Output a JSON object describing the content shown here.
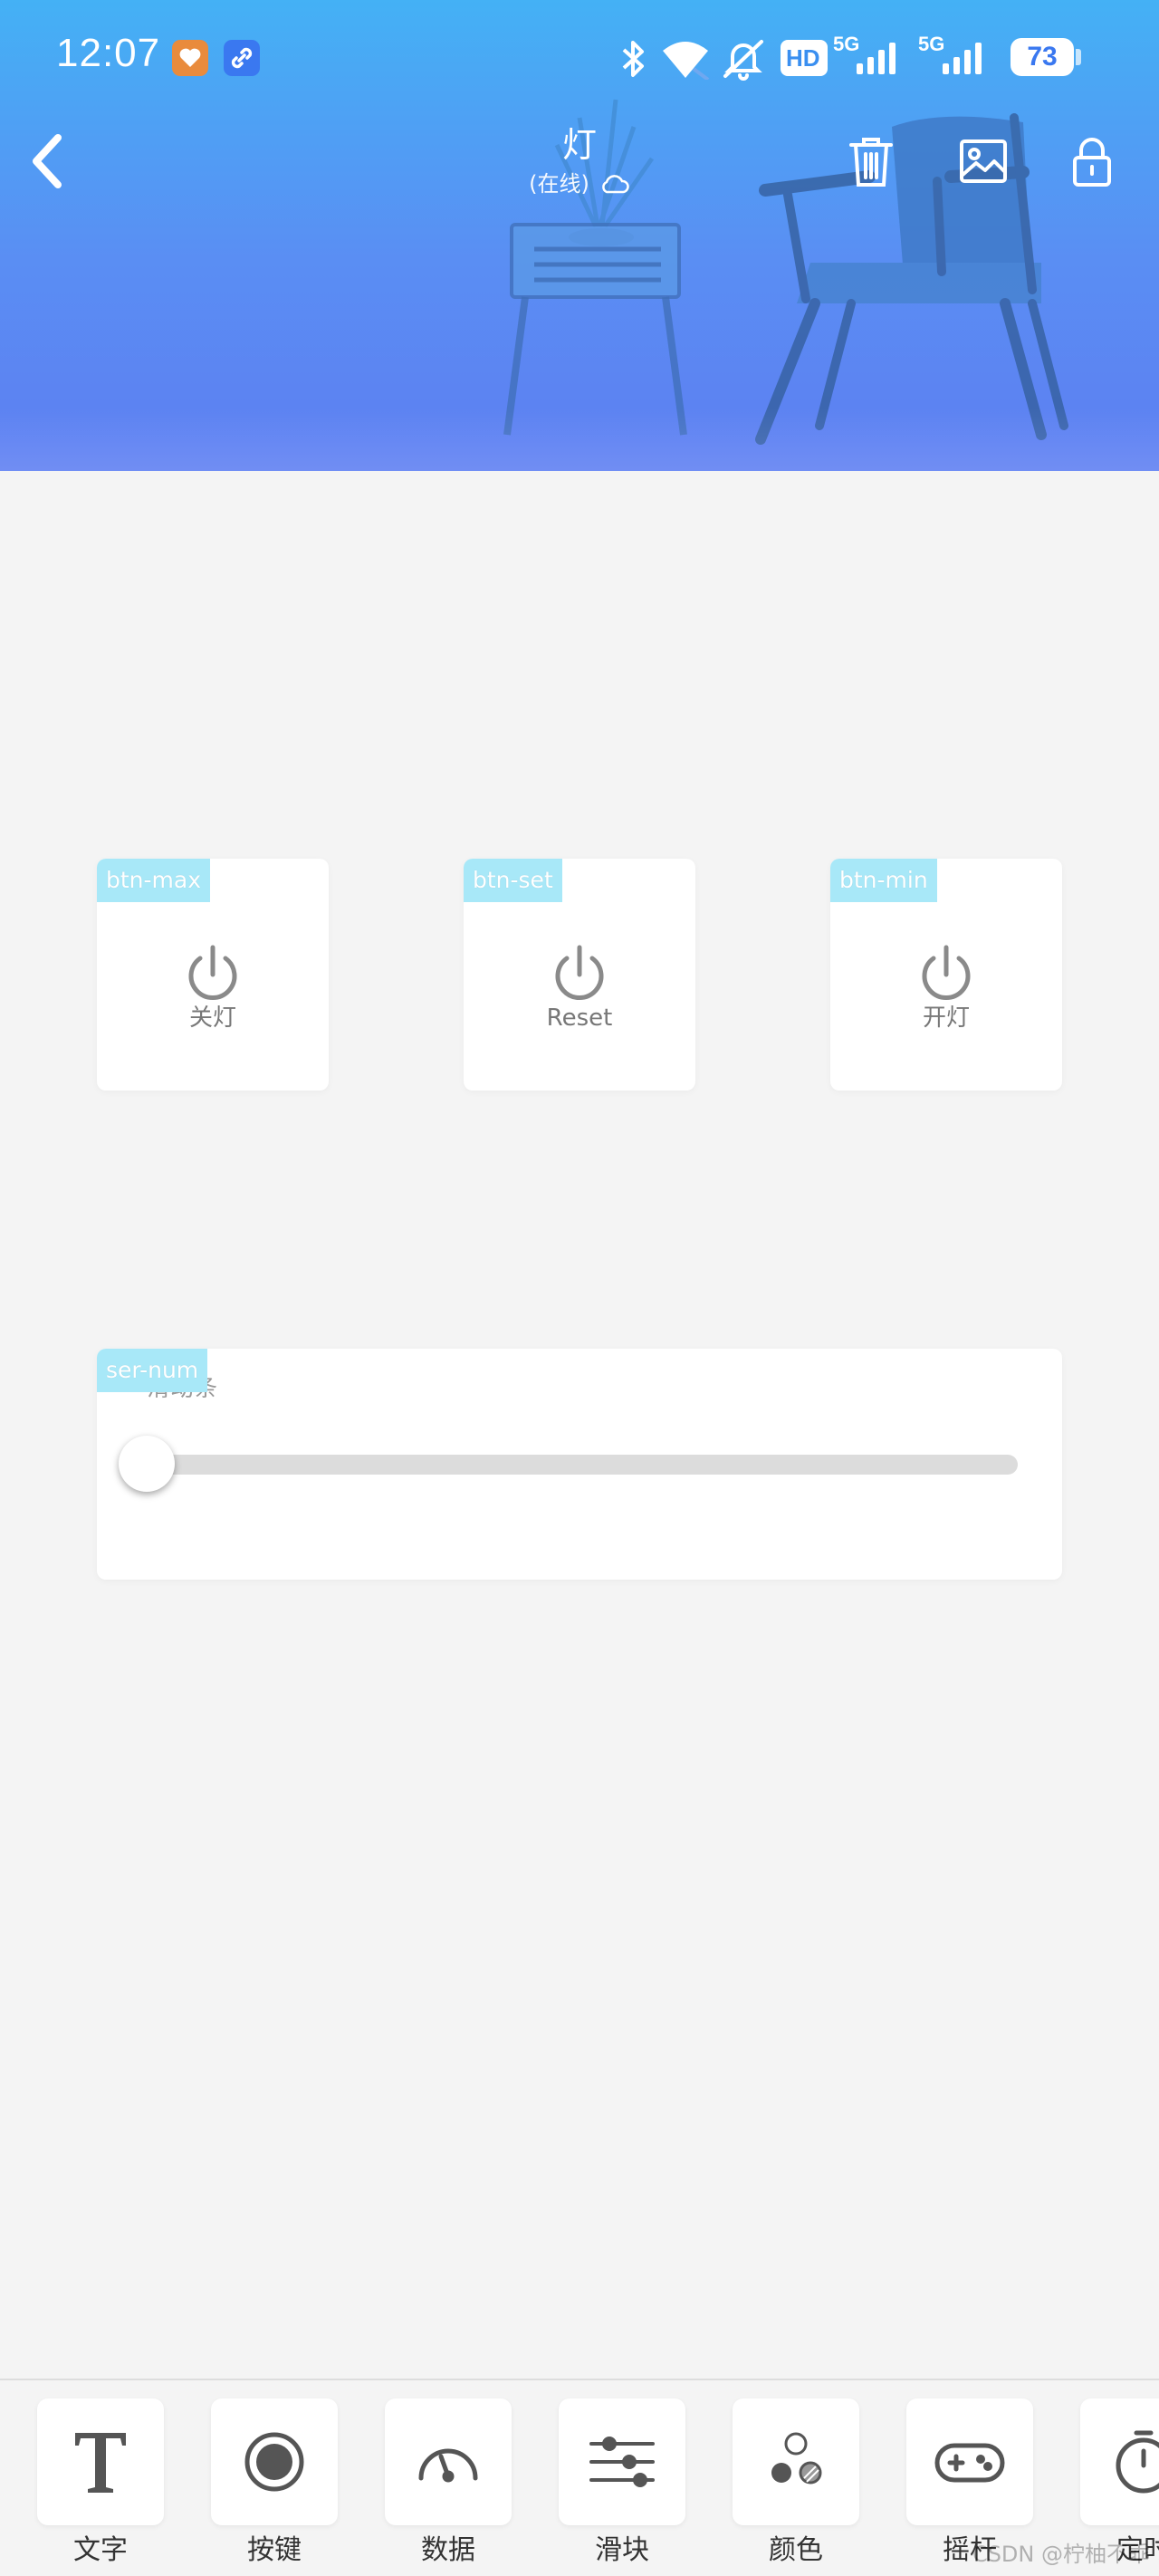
{
  "status_bar": {
    "time": "12:07",
    "hd_badge": "HD",
    "network_1": "5G",
    "network_2": "5G",
    "battery": "73",
    "icons": [
      "heart-app-icon",
      "link-app-icon",
      "bluetooth-icon",
      "wifi-icon",
      "mute-icon",
      "signal-icon",
      "signal-icon",
      "battery-icon"
    ]
  },
  "header": {
    "title": "灯",
    "subtitle": "(在线)",
    "icons": [
      "back-icon",
      "cloud-icon",
      "trash-icon",
      "image-icon",
      "lock-icon"
    ]
  },
  "buttons": [
    {
      "key": "btn-max",
      "label": "关灯",
      "icon": "power-icon"
    },
    {
      "key": "btn-set",
      "label": "Reset",
      "icon": "power-icon"
    },
    {
      "key": "btn-min",
      "label": "开灯",
      "icon": "power-icon"
    }
  ],
  "slider": {
    "key": "ser-num",
    "label": "滑动条",
    "value_fraction": 0.0
  },
  "toolbar": {
    "items": [
      {
        "label": "文字",
        "icon": "text-icon"
      },
      {
        "label": "按键",
        "icon": "button-icon"
      },
      {
        "label": "数据",
        "icon": "gauge-icon"
      },
      {
        "label": "滑块",
        "icon": "slider-icon"
      },
      {
        "label": "颜色",
        "icon": "color-icon"
      },
      {
        "label": "摇杆",
        "icon": "gamepad-icon"
      },
      {
        "label": "定时",
        "icon": "timer-icon"
      }
    ]
  },
  "watermark": "CSDN @柠柚不乖",
  "colors": {
    "header_gradient_top": "#44b1f5",
    "header_gradient_bottom": "#5d7ef2",
    "widget_key_bg": "#a8e8f8",
    "page_bg": "#f4f4f4"
  }
}
